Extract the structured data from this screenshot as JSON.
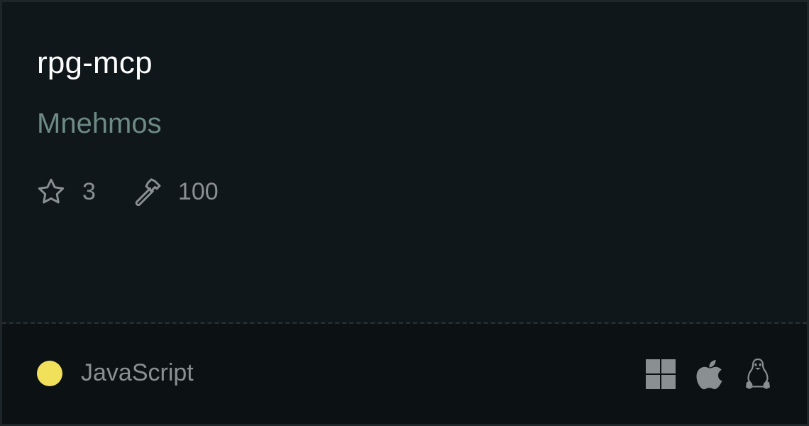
{
  "repo": {
    "name": "rpg-mcp",
    "owner": "Mnehmos"
  },
  "stats": {
    "stars": "3",
    "stars_icon": "star-icon",
    "tools": "100",
    "tools_icon": "hammer-icon"
  },
  "language": {
    "name": "JavaScript",
    "color": "#f1e05a"
  },
  "platforms": [
    {
      "name": "windows-icon"
    },
    {
      "name": "apple-icon"
    },
    {
      "name": "linux-icon"
    }
  ],
  "colors": {
    "background": "#10171a",
    "footer_background": "#0c1113",
    "title": "#ffffff",
    "owner": "#6d8a84",
    "muted": "#8a8f92"
  }
}
